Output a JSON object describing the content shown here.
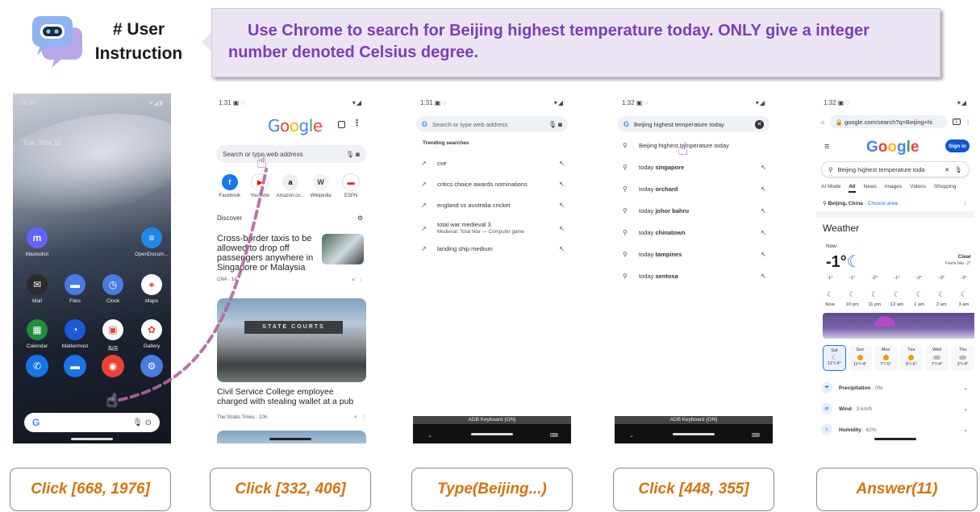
{
  "header": {
    "label": "# User Instruction",
    "instruction": "Use Chrome to search for Beijing highest temperature today. ONLY give a integer number denoted Celsius degree."
  },
  "phone1": {
    "time": "10:49",
    "status_right": "▾◢▮",
    "date_text": "Tue, Nov 11",
    "apps_row1": [
      {
        "label": "Mastodon",
        "color": "#6364ff",
        "glyph": "m"
      },
      {
        "label": "OpenDocum...",
        "color": "#1e88e5",
        "glyph": "≡"
      }
    ],
    "apps_row2": [
      {
        "label": "Mail",
        "color": "#2b2b2b",
        "glyph": "✉"
      },
      {
        "label": "Files",
        "color": "#4a7be0",
        "glyph": "▬"
      },
      {
        "label": "Clock",
        "color": "#4a7be0",
        "glyph": "◷"
      },
      {
        "label": "Maps",
        "color": "#ffffff",
        "glyph": "⌖"
      }
    ],
    "apps_row3": [
      {
        "label": "Calendar",
        "color": "#1e8e3e",
        "glyph": "▦"
      },
      {
        "label": "Mattermost",
        "color": "#1c58d9",
        "glyph": "◔"
      },
      {
        "label": "淘店",
        "color": "#ffffff",
        "glyph": "▣"
      },
      {
        "label": "Gallery",
        "color": "#ffffff",
        "glyph": "✿"
      }
    ],
    "dock": [
      {
        "name": "phone",
        "color": "#1a73e8",
        "glyph": "✆"
      },
      {
        "name": "messages",
        "color": "#1a73e8",
        "glyph": "▬"
      },
      {
        "name": "chrome",
        "color": "#ea4335",
        "glyph": "◉"
      },
      {
        "name": "settings",
        "color": "#4a7be0",
        "glyph": "⚙"
      }
    ],
    "search_g": "G"
  },
  "phone2": {
    "time": "1:31",
    "status_left_icons": "▣ ◌",
    "status_right": "▾◢",
    "logo": [
      "G",
      "o",
      "o",
      "g",
      "l",
      "e"
    ],
    "search_placeholder": "Search or type web address",
    "shortcuts": [
      {
        "label": "Facebook",
        "bg": "#1877f2",
        "fg": "#fff",
        "glyph": "f"
      },
      {
        "label": "YouTube",
        "bg": "#ffffff",
        "fg": "#ff0000",
        "glyph": "▶"
      },
      {
        "label": "Amazon.co...",
        "bg": "#eeeeee",
        "fg": "#000",
        "glyph": "a"
      },
      {
        "label": "Wikipedia",
        "bg": "#f3f3f3",
        "fg": "#444",
        "glyph": "W"
      },
      {
        "label": "ESPN",
        "bg": "#ffffff",
        "fg": "#e31b23",
        "glyph": "▬"
      }
    ],
    "discover": "Discover",
    "card1_title": "Cross-border taxis to be allowed to drop off passengers anywhere in Singapore or Malaysia",
    "card1_source": "CNA · 1d",
    "card2_banner": "STATE COURTS",
    "card2_title": "Civil Service College employee charged with stealing wallet at a pub",
    "card2_source": "The Straits Times · 10h"
  },
  "phone3": {
    "time": "1:31",
    "status_left_icons": "▣ ◌",
    "status_right": "▾◢",
    "search_placeholder": "Search or type web address",
    "trending_header": "Trending searches",
    "trending": [
      {
        "text": "cve",
        "sub": ""
      },
      {
        "text": "critics choice awards nominations",
        "sub": ""
      },
      {
        "text": "england vs australia cricket",
        "sub": ""
      },
      {
        "text": "total war medieval 3",
        "sub": "Medieval: Total War — Computer game"
      },
      {
        "text": "landing ship medium",
        "sub": ""
      }
    ],
    "keyboard_label": "ADB Keyboard {ON}"
  },
  "phone4": {
    "time": "1:32",
    "status_left_icons": "▣ ◌",
    "status_right": "▾◢",
    "query": "Beijing highest temperature today",
    "suggestions": [
      {
        "prefix": "Beijing highest temperature today",
        "bold": ""
      },
      {
        "prefix": "today ",
        "bold": "singapore"
      },
      {
        "prefix": "today ",
        "bold": "orchard"
      },
      {
        "prefix": "today ",
        "bold": "johor bahru"
      },
      {
        "prefix": "today ",
        "bold": "chinatown"
      },
      {
        "prefix": "today ",
        "bold": "tampines"
      },
      {
        "prefix": "today ",
        "bold": "sentosa"
      }
    ],
    "keyboard_label": "ADB Keyboard {ON}"
  },
  "phone5": {
    "time": "1:32",
    "status_left_icons": "▣ ◌",
    "status_right": "▾◢",
    "url": "google.com/search?q=Beijing+hi",
    "tab_count": "1",
    "sign_in": "Sign in",
    "query": "Beijing highest temperature toda",
    "tabs": [
      "AI Mode",
      "All",
      "News",
      "Images",
      "Videos",
      "Shopping"
    ],
    "location_bold": "Beijing, China",
    "location_link": "Choose area",
    "weather_title": "Weather",
    "now_label": "Now",
    "now_temp": "-1°",
    "condition": "Clear",
    "feels_like": "Feels like -2°",
    "hourly": [
      {
        "temp": "-1°",
        "time": "Now"
      },
      {
        "temp": "-1°",
        "time": "10 pm"
      },
      {
        "temp": "-2°",
        "time": "11 pm"
      },
      {
        "temp": "-1°",
        "time": "12 am"
      },
      {
        "temp": "-2°",
        "time": "1 am"
      },
      {
        "temp": "-3°",
        "time": "2 am"
      },
      {
        "temp": "-3°",
        "time": "3 am"
      }
    ],
    "daily": [
      {
        "day": "Sat",
        "range": "11°/-4°",
        "icon": "moon",
        "selected": true
      },
      {
        "day": "Sun",
        "range": "11°/-4°",
        "icon": "sun",
        "selected": false
      },
      {
        "day": "Mon",
        "range": "7°/-5°",
        "icon": "sun",
        "selected": false
      },
      {
        "day": "Tue",
        "range": "6°/-6°",
        "icon": "sun",
        "selected": false
      },
      {
        "day": "Wed",
        "range": "7°/-4°",
        "icon": "cloud",
        "selected": false
      },
      {
        "day": "Thu",
        "range": "3°/-4°",
        "icon": "cloud",
        "selected": false
      }
    ],
    "details": [
      {
        "label": "Precipitation",
        "value": "0%"
      },
      {
        "label": "Wind",
        "value": "3 km/h"
      },
      {
        "label": "Humidity",
        "value": "62%"
      }
    ]
  },
  "actions": [
    "Click [668, 1976]",
    "Click [332, 406]",
    "Type(Beijing...)",
    "Click [448, 355]",
    "Answer(11)"
  ],
  "colors": {
    "instruction_text": "#7b3fb5",
    "instruction_bg": "#ebe4f2",
    "action_text": "#d4740c",
    "trail": "#b0669a",
    "hand": "#7b2fa3"
  }
}
